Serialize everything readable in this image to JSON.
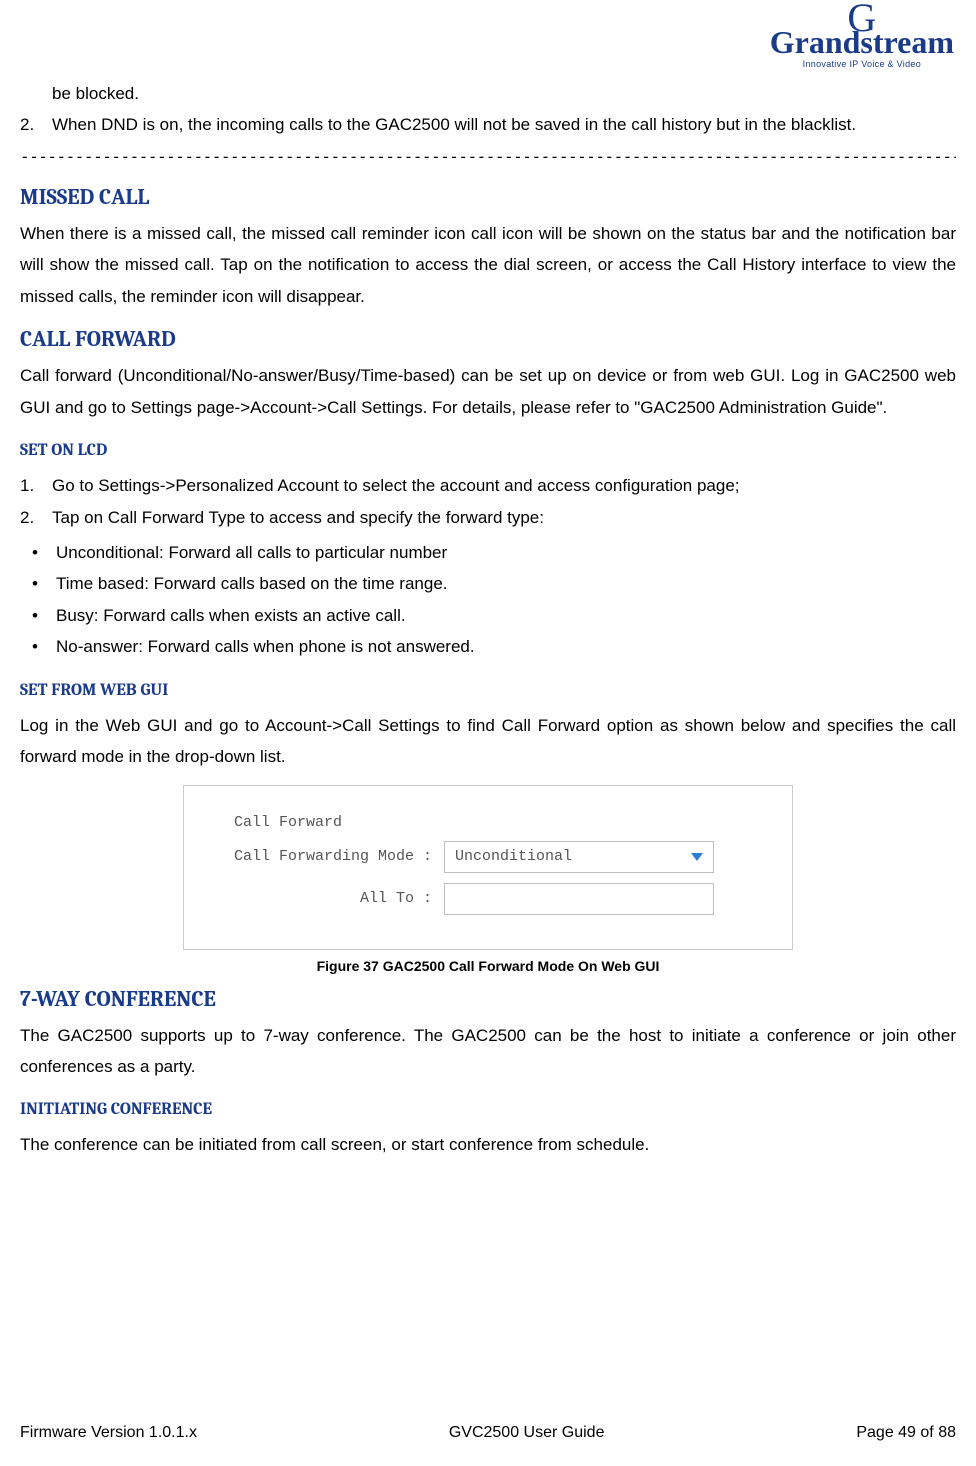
{
  "logo": {
    "brand": "Grandstream",
    "tagline": "Innovative IP Voice & Video"
  },
  "cont": {
    "item1": "be blocked.",
    "item2_n": "2.",
    "item2": "When DND is on, the incoming calls to the GAC2500 will not be saved in the call history but in the blacklist.",
    "dashes": "--------------------------------------------------------------------------------------------------------------------------"
  },
  "missed": {
    "title": "MISSED CALL",
    "body": "When there is a missed call, the missed call reminder icon call icon will be shown on the status bar and the notification bar will show the missed call. Tap on the notification to access the dial screen, or access the Call History interface to view the missed calls, the reminder icon will disappear."
  },
  "fwd": {
    "title": "CALL FORWARD",
    "body": "Call forward (Unconditional/No-answer/Busy/Time-based) can be set up on device or from web GUI. Log in GAC2500 web GUI and go to Settings page->Account->Call Settings. For details, please refer to \"GAC2500 Administration Guide\"."
  },
  "lcd": {
    "title": "SET ON LCD",
    "n1": "1.",
    "t1": "Go to Settings->Personalized Account to select the account and access configuration page;",
    "n2": "2.",
    "t2": "Tap on Call Forward Type to access and specify the forward type:",
    "b1": "Unconditional: Forward all calls to particular number",
    "b2": "Time based: Forward calls based on the time range.",
    "b3": "Busy: Forward calls when exists an active call.",
    "b4": "No-answer: Forward calls when phone is not answered."
  },
  "web": {
    "title": "SET FROM WEB GUI",
    "body": "Log in the Web GUI and go to Account->Call Settings to find Call Forward option as shown below and specifies the call forward mode in the drop-down list."
  },
  "fig": {
    "heading": "Call Forward",
    "mode_label": "Call Forwarding Mode :",
    "mode_value": "Unconditional",
    "all_label": "All To :",
    "caption": "Figure 37 GAC2500 Call Forward Mode On Web GUI"
  },
  "conf": {
    "title": "7-WAY CONFERENCE",
    "body": "The GAC2500 supports up to 7-way conference. The GAC2500 can be the host to initiate a conference or join other conferences as a party."
  },
  "init": {
    "title": "INITIATING CONFERENCE",
    "body": "The conference can be initiated from call screen, or start conference from schedule."
  },
  "footer": {
    "left": "Firmware Version 1.0.1.x",
    "center": "GVC2500 User Guide",
    "right": "Page 49 of 88"
  }
}
